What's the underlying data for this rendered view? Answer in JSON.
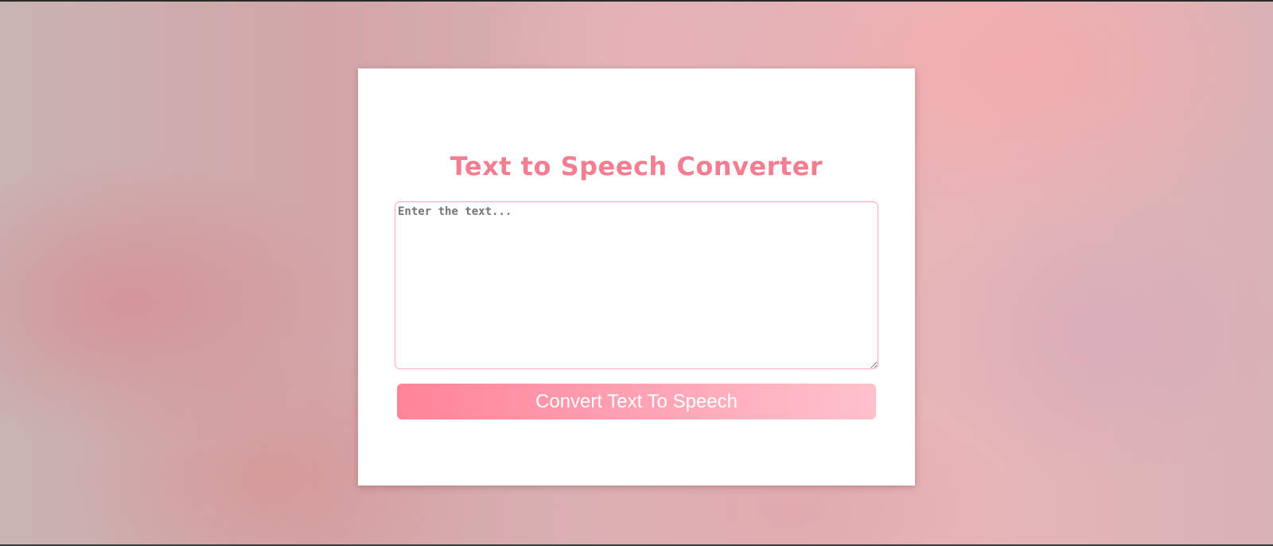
{
  "app": {
    "title": "Text to Speech Converter"
  },
  "input": {
    "placeholder": "Enter the text...",
    "value": ""
  },
  "actions": {
    "convert_label": "Convert Text To Speech"
  },
  "colors": {
    "accent": "#f37e92",
    "button_gradient_start": "#ff8499",
    "button_gradient_end": "#ffc1cc",
    "input_border": "#f5a8b8"
  }
}
